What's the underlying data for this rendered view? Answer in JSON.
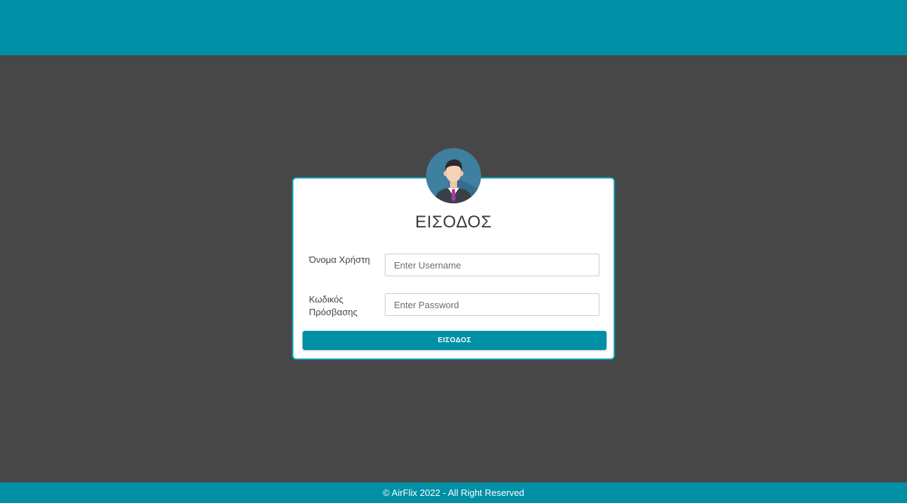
{
  "colors": {
    "accent": "#0090a6",
    "page_background": "#474747",
    "card_background": "#ffffff",
    "card_border": "#0c9fb3"
  },
  "avatar": {
    "icon": "user-avatar-icon"
  },
  "login": {
    "title": "ΕΙΣΟΔΟΣ",
    "username_label": "Όνομα Χρήστη",
    "username_placeholder": "Enter Username",
    "username_value": "",
    "password_label": "Κωδικός Πρόσβασης",
    "password_placeholder": "Enter Password",
    "password_value": "",
    "submit_label": "ΕΙΣΟΔΟΣ"
  },
  "footer": {
    "text": "© AirFlix 2022 - All Right Reserved"
  }
}
